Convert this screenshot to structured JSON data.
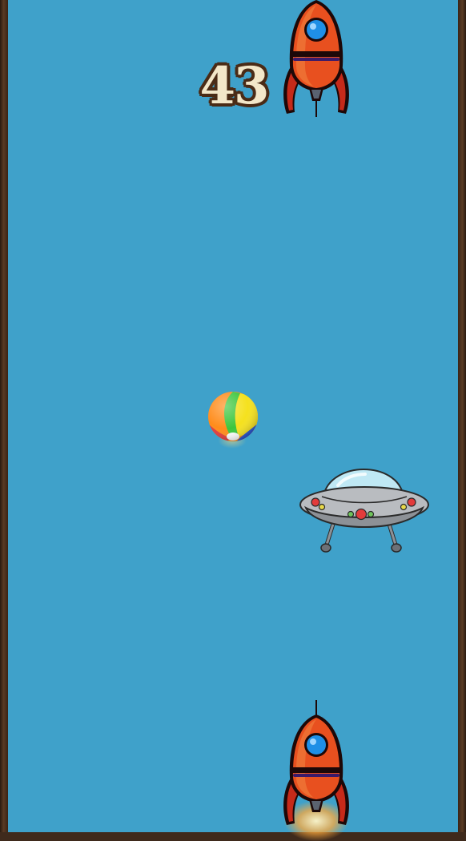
{
  "hud": {
    "score": "43"
  },
  "sprites": {
    "rocket_color": "#e8501f",
    "rocket_window": "#1f8fe6",
    "ball_colors": [
      "#ff8c1a",
      "#3cc63c",
      "#f5e11e",
      "#2b58d8",
      "#e23b3b",
      "#ffffff"
    ],
    "ufo_body": "#b9bcc0",
    "ufo_dome": "#bfe8f4",
    "background": "#3fa1ca",
    "walls": "#3f2a1c"
  }
}
